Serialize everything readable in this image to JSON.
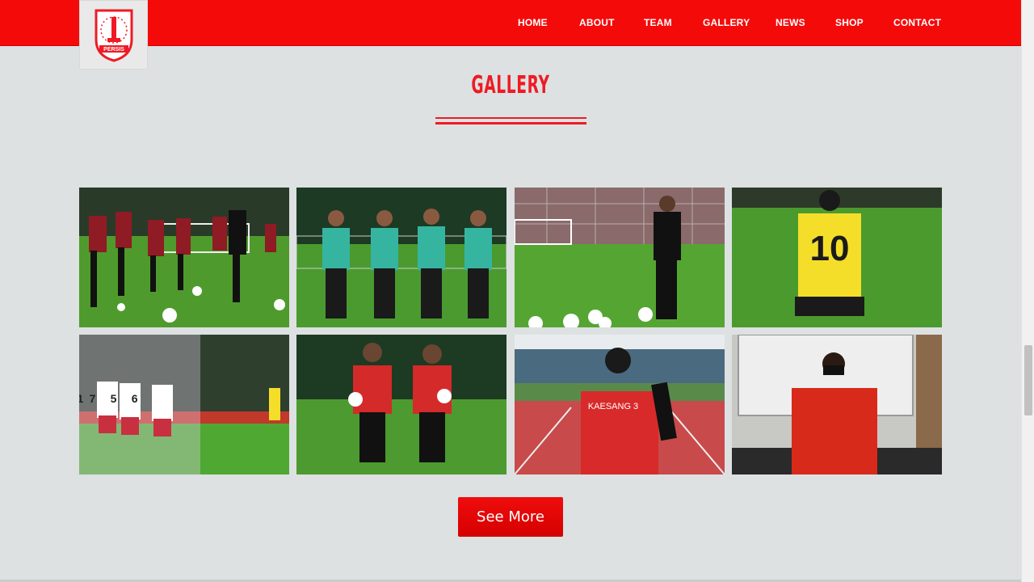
{
  "brand": {
    "logo_text": "PERSIS",
    "primary_color": "#f50a0a",
    "accent_color": "#ee1b24"
  },
  "nav": {
    "items": [
      "HOME",
      "ABOUT",
      "TEAM",
      "GALLERY",
      "NEWS",
      "SHOP",
      "CONTACT"
    ]
  },
  "gallery": {
    "title": "GALLERY",
    "photos": [
      {
        "jersey": ""
      },
      {
        "jersey": ""
      },
      {
        "jersey": ""
      },
      {
        "jersey": "10"
      },
      {
        "jersey": "17 5 6"
      },
      {
        "jersey": ""
      },
      {
        "jersey": "KAESANG 3"
      },
      {
        "jersey": ""
      }
    ],
    "see_more_label": "See More"
  }
}
